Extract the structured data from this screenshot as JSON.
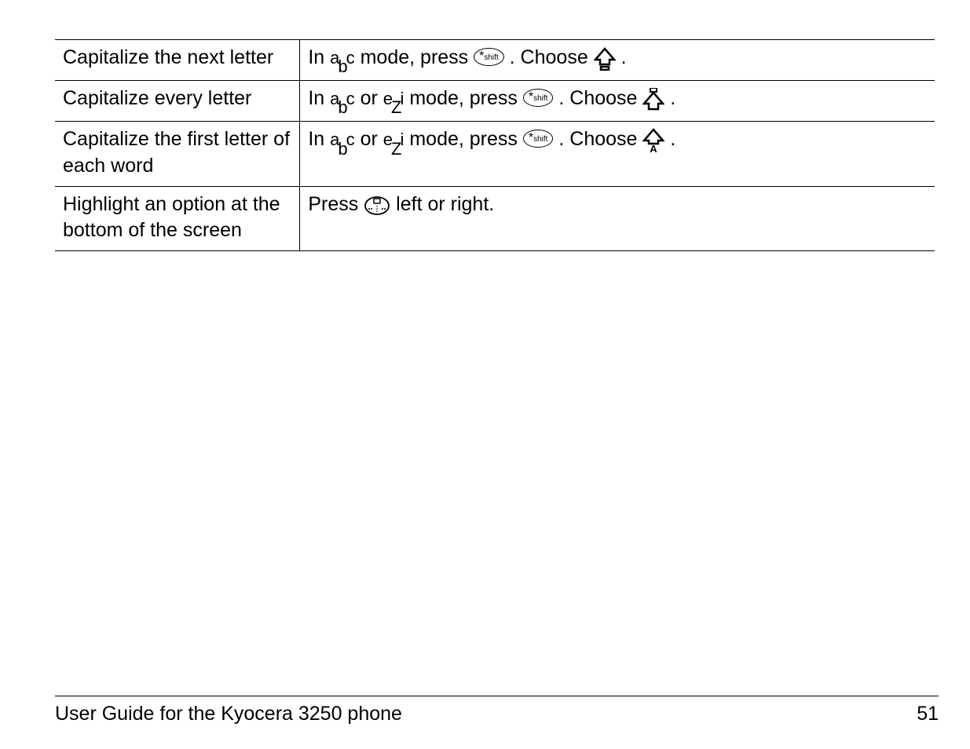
{
  "rows": [
    {
      "label": "Capitalize the next letter",
      "before_mode": "In ",
      "mode1": "abc",
      "mode2": null,
      "mode_sep": "",
      "after_mode": " mode, press ",
      "after_press": ". Choose ",
      "choose_icon": "shift-outline",
      "tail": " ."
    },
    {
      "label": "Capitalize every letter",
      "before_mode": "In ",
      "mode1": "abc",
      "mode2": "ezi",
      "mode_sep": " or ",
      "after_mode": " mode, press ",
      "after_press": ". Choose ",
      "choose_icon": "shift-lock",
      "tail": "."
    },
    {
      "label": "Capitalize the first letter of each word",
      "before_mode": "In ",
      "mode1": "abc",
      "mode2": "ezi",
      "mode_sep": " or ",
      "after_mode": " mode, press ",
      "after_press": ". Choose ",
      "choose_icon": "shift-a",
      "tail": "."
    },
    {
      "label": "Highlight an option at the bottom of the screen",
      "press_prefix": "Press ",
      "press_suffix": " left or right."
    }
  ],
  "shift_key": {
    "star": "*",
    "label": "shift"
  },
  "footer": {
    "title": "User Guide for the Kyocera 3250 phone",
    "page": "51"
  }
}
